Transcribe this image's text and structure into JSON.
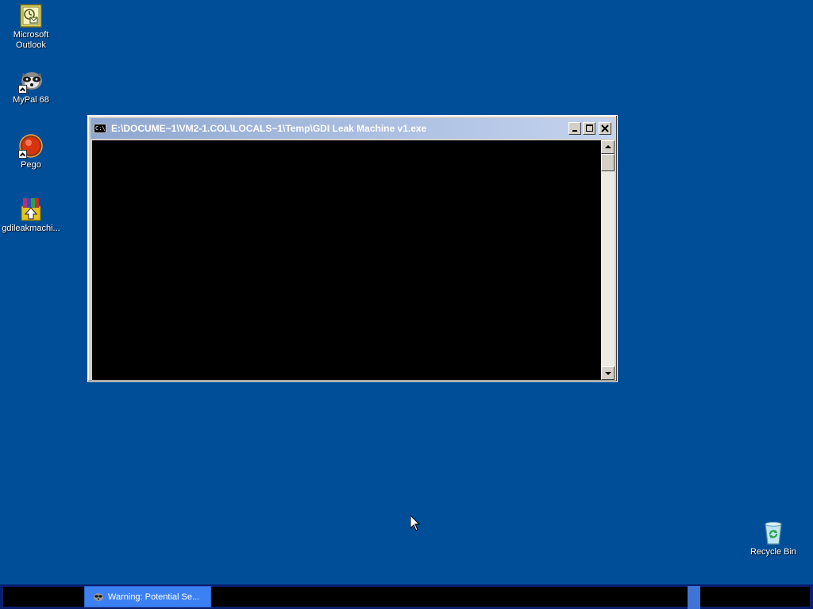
{
  "desktop": {
    "background_color": "#004e98",
    "icons": [
      {
        "label": "Microsoft Outlook",
        "icon": "outlook-icon"
      },
      {
        "label": "MyPal 68",
        "icon": "mypal-icon"
      },
      {
        "label": "Pego",
        "icon": "pego-icon"
      },
      {
        "label": "gdileakmachi...",
        "icon": "installer-icon"
      },
      {
        "label": "Recycle Bin",
        "icon": "recycle-bin-icon"
      }
    ]
  },
  "window": {
    "title": "E:\\DOCUME~1\\VM2-1.COL\\LOCALS~1\\Temp\\GDI Leak Machine v1.exe",
    "icon_text": "C:\\",
    "minimize_label": "_",
    "maximize_label": "□",
    "close_label": "✕",
    "console_background": "#000000"
  },
  "taskbar": {
    "task_button_label": "Warning: Potential Se...",
    "accent_color": "#3c81f3"
  }
}
